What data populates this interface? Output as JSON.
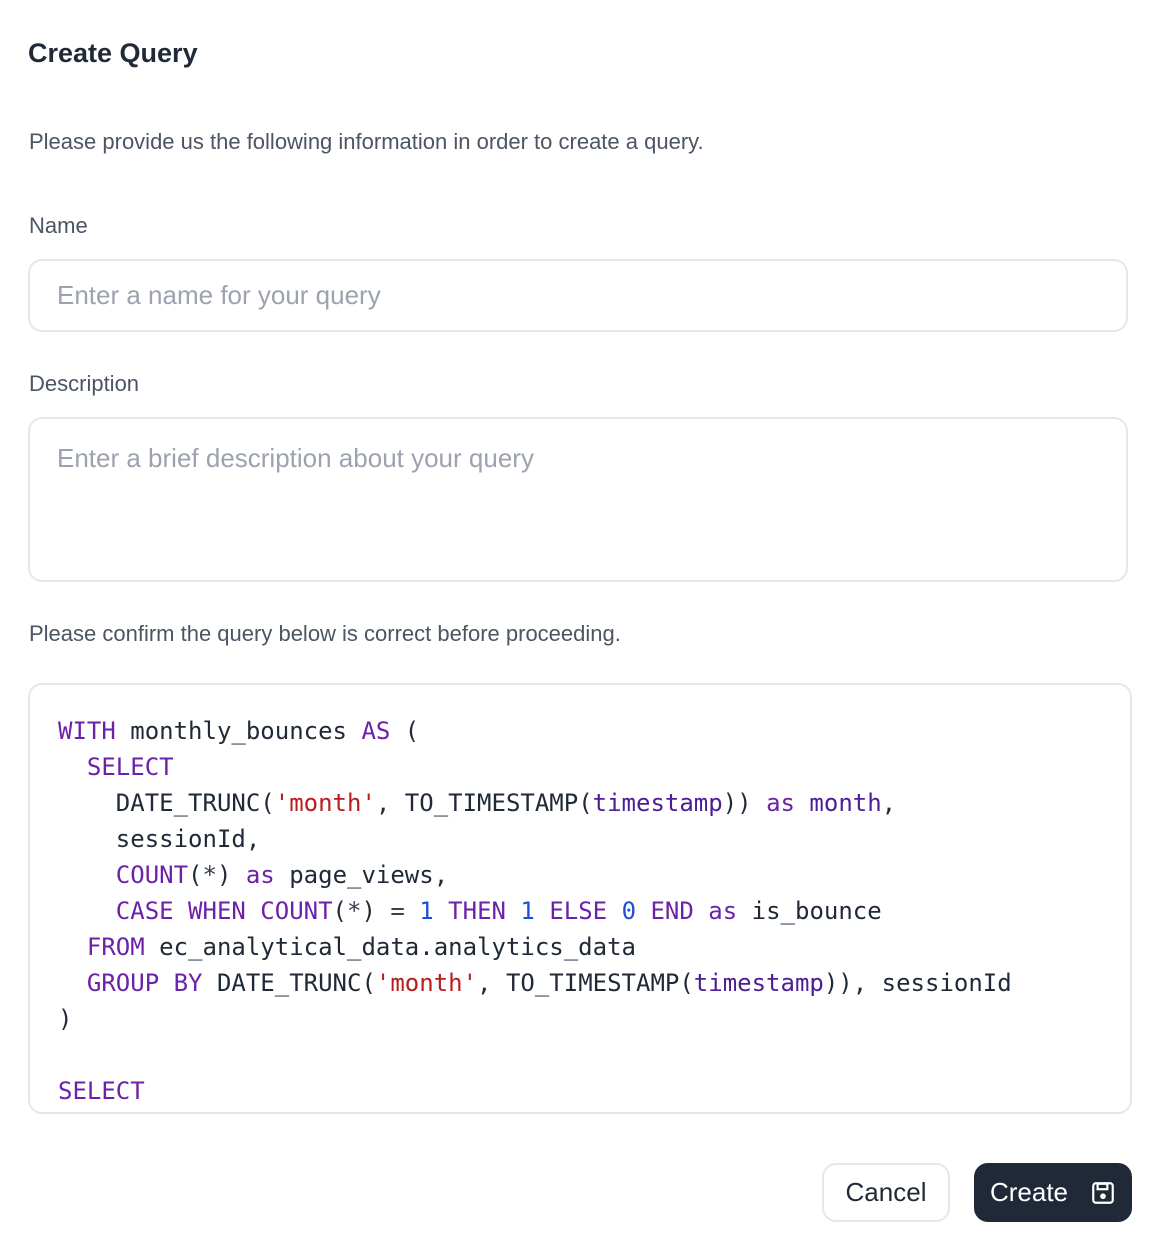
{
  "dialog": {
    "title": "Create Query",
    "intro": "Please provide us the following information in order to create a query."
  },
  "form": {
    "name_label": "Name",
    "name_placeholder": "Enter a name for your query",
    "name_value": "",
    "description_label": "Description",
    "description_placeholder": "Enter a brief description about your query",
    "description_value": ""
  },
  "query": {
    "confirm_text": "Please confirm the query below is correct before proceeding.",
    "lines": [
      [
        {
          "t": "kw",
          "v": "WITH"
        },
        {
          "t": "plain",
          "v": " monthly_bounces "
        },
        {
          "t": "kw",
          "v": "AS"
        },
        {
          "t": "plain",
          "v": " ("
        }
      ],
      [
        {
          "t": "plain",
          "v": "  "
        },
        {
          "t": "kw",
          "v": "SELECT"
        }
      ],
      [
        {
          "t": "plain",
          "v": "    DATE_TRUNC("
        },
        {
          "t": "str",
          "v": "'month'"
        },
        {
          "t": "plain",
          "v": ", TO_TIMESTAMP("
        },
        {
          "t": "ident",
          "v": "timestamp"
        },
        {
          "t": "plain",
          "v": ")) "
        },
        {
          "t": "kw",
          "v": "as"
        },
        {
          "t": "plain",
          "v": " "
        },
        {
          "t": "ident",
          "v": "month"
        },
        {
          "t": "plain",
          "v": ","
        }
      ],
      [
        {
          "t": "plain",
          "v": "    sessionId,"
        }
      ],
      [
        {
          "t": "plain",
          "v": "    "
        },
        {
          "t": "kw",
          "v": "COUNT"
        },
        {
          "t": "plain",
          "v": "("
        },
        {
          "t": "op",
          "v": "*"
        },
        {
          "t": "plain",
          "v": ") "
        },
        {
          "t": "kw",
          "v": "as"
        },
        {
          "t": "plain",
          "v": " page_views,"
        }
      ],
      [
        {
          "t": "plain",
          "v": "    "
        },
        {
          "t": "kw",
          "v": "CASE"
        },
        {
          "t": "plain",
          "v": " "
        },
        {
          "t": "kw",
          "v": "WHEN"
        },
        {
          "t": "plain",
          "v": " "
        },
        {
          "t": "kw",
          "v": "COUNT"
        },
        {
          "t": "plain",
          "v": "("
        },
        {
          "t": "op",
          "v": "*"
        },
        {
          "t": "plain",
          "v": ") "
        },
        {
          "t": "op",
          "v": "="
        },
        {
          "t": "plain",
          "v": " "
        },
        {
          "t": "num",
          "v": "1"
        },
        {
          "t": "plain",
          "v": " "
        },
        {
          "t": "kw",
          "v": "THEN"
        },
        {
          "t": "plain",
          "v": " "
        },
        {
          "t": "num",
          "v": "1"
        },
        {
          "t": "plain",
          "v": " "
        },
        {
          "t": "kw",
          "v": "ELSE"
        },
        {
          "t": "plain",
          "v": " "
        },
        {
          "t": "num",
          "v": "0"
        },
        {
          "t": "plain",
          "v": " "
        },
        {
          "t": "kw",
          "v": "END"
        },
        {
          "t": "plain",
          "v": " "
        },
        {
          "t": "kw",
          "v": "as"
        },
        {
          "t": "plain",
          "v": " is_bounce"
        }
      ],
      [
        {
          "t": "plain",
          "v": "  "
        },
        {
          "t": "kw",
          "v": "FROM"
        },
        {
          "t": "plain",
          "v": " ec_analytical_data.analytics_data"
        }
      ],
      [
        {
          "t": "plain",
          "v": "  "
        },
        {
          "t": "kw",
          "v": "GROUP BY"
        },
        {
          "t": "plain",
          "v": " DATE_TRUNC("
        },
        {
          "t": "str",
          "v": "'month'"
        },
        {
          "t": "plain",
          "v": ", TO_TIMESTAMP("
        },
        {
          "t": "ident",
          "v": "timestamp"
        },
        {
          "t": "plain",
          "v": ")), sessionId"
        }
      ],
      [
        {
          "t": "plain",
          "v": ")"
        }
      ],
      [
        {
          "t": "plain",
          "v": ""
        }
      ],
      [
        {
          "t": "kw",
          "v": "SELECT"
        }
      ]
    ]
  },
  "actions": {
    "cancel_label": "Cancel",
    "create_label": "Create",
    "create_icon": "save-icon"
  },
  "colors": {
    "primary_button": "#1f2937",
    "keyword": "#6b21a8",
    "string": "#b91c1c",
    "number": "#1d4ed8"
  }
}
